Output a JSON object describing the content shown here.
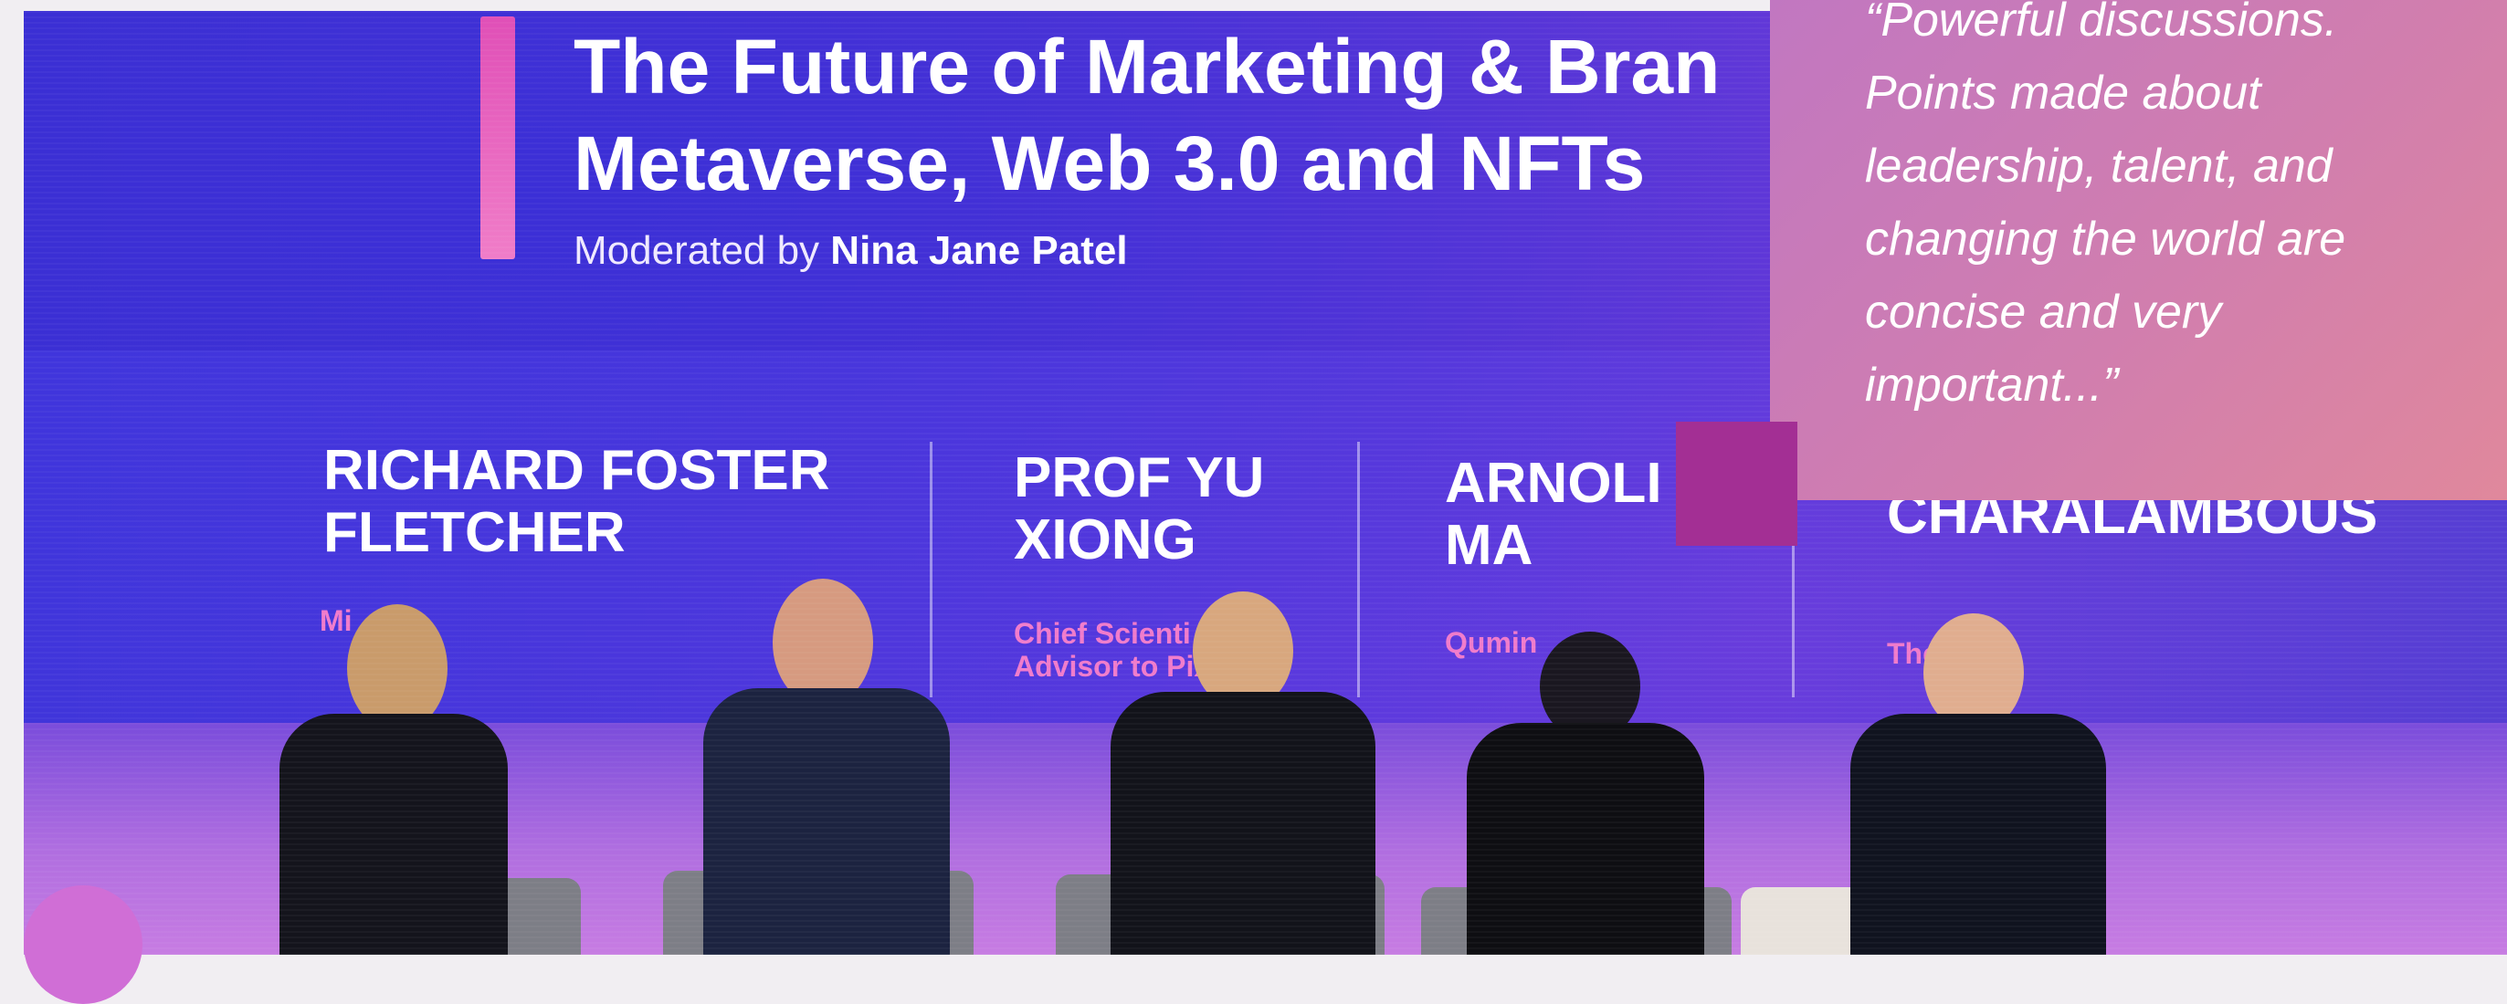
{
  "stage": {
    "title_line1": "The Future of Marketing & Bran",
    "title_line2": "Metaverse, Web 3.0 and NFTs",
    "moderated_label": "Moderated by",
    "moderator_name": "Nina Jane Patel"
  },
  "speakers": [
    {
      "name_line1": "RICHARD FOSTER",
      "name_line2": "FLETCHER",
      "org": "Mi"
    },
    {
      "name_line1": "PROF YU",
      "name_line2": "XIONG",
      "org_line1": "Chief Scienti",
      "org_line2": "Advisor to Pix"
    },
    {
      "name_line1": "ARNOLI",
      "name_line2": "MA",
      "org": "Qumin"
    },
    {
      "name_line1": "",
      "name_line2": "CHARALAMBOUS",
      "org": "The        n"
    }
  ],
  "quote": {
    "line1": "“Powerful discussions.",
    "line2": "Points made about",
    "line3": "leadership, talent, and",
    "line4": "changing the world are",
    "line5": "concise and very",
    "line6": "important...”"
  },
  "colors": {
    "screen_blue": "#3a2fd0",
    "accent_pink": "#e04fb7",
    "quote_card": "#c177c1",
    "quote_square": "#a32f94"
  }
}
